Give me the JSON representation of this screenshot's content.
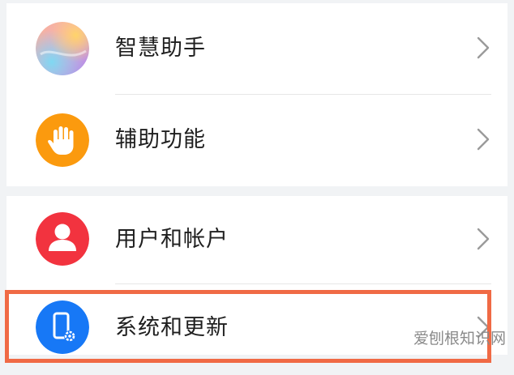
{
  "settings_list": {
    "items": [
      {
        "label": "智慧助手",
        "icon": "smart-assistant-icon"
      },
      {
        "label": "辅助功能",
        "icon": "hand-icon"
      },
      {
        "label": "用户和帐户",
        "icon": "user-icon"
      },
      {
        "label": "系统和更新",
        "icon": "phone-settings-icon"
      }
    ]
  },
  "highlight": {
    "color": "#f06a45"
  },
  "watermark": {
    "text": "爱刨根知识网"
  },
  "colors": {
    "accessibility_orange": "#fb9a0e",
    "user_red": "#f2333f",
    "system_blue": "#1778f6"
  }
}
